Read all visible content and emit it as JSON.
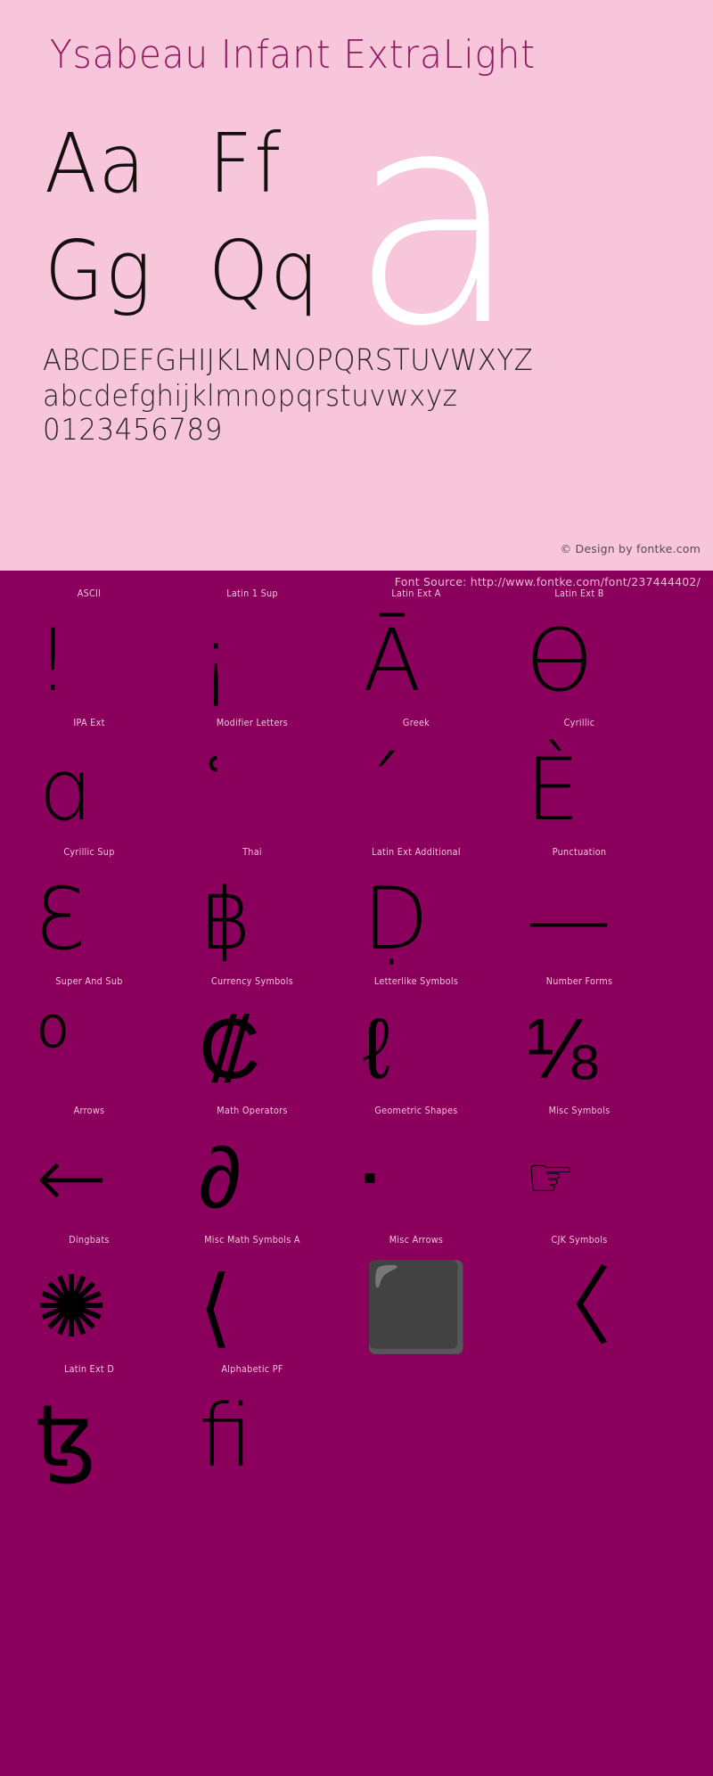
{
  "colors": {
    "background_pink": "#f7c6da",
    "background_magenta": "#8a005c",
    "title_magenta": "#8e1a63",
    "glyph_black": "#000000",
    "hero_white": "#ffffff",
    "label_pink": "#f2c4da"
  },
  "specimen": {
    "title": "Ysabeau Infant ExtraLight",
    "letter_pairs": [
      "Aa",
      "Ff",
      "Gg",
      "Qq"
    ],
    "hero_glyph": "a",
    "alphabet_upper": "ABCDEFGHIJKLMNOPQRSTUVWXYZ",
    "alphabet_lower": "abcdefghijklmnopqrstuvwxyz",
    "digits": "0123456789",
    "design_credit": "© Design by fontke.com"
  },
  "source": {
    "label": "Font Source: http://www.fontke.com/font/237444402/"
  },
  "grid": {
    "rows": [
      [
        {
          "label": "ASCII",
          "glyph": "!",
          "icon": "exclamation-glyph",
          "size": "tall",
          "align": "offset-left"
        },
        {
          "label": "Latin 1 Sup",
          "glyph": "¡",
          "icon": "inverted-exclamation-glyph",
          "size": "tall",
          "align": "offset-left"
        },
        {
          "label": "Latin Ext A",
          "glyph": "Ā",
          "icon": "a-macron-glyph",
          "size": "tall",
          "align": "offset-left"
        },
        {
          "label": "Latin Ext B",
          "glyph": "Ɵ",
          "icon": "barred-o-glyph",
          "size": "tall",
          "align": "offset-left"
        }
      ],
      [
        {
          "label": "IPA Ext",
          "glyph": "ɑ",
          "icon": "latin-alpha-glyph",
          "size": "tall",
          "align": "offset-left"
        },
        {
          "label": "Modifier Letters",
          "glyph": "ʿ",
          "icon": "modifier-half-ring-glyph",
          "size": "tall",
          "align": "offset-left"
        },
        {
          "label": "Greek",
          "glyph": "΄",
          "icon": "greek-tonos-glyph",
          "size": "tall",
          "align": "offset-left"
        },
        {
          "label": "Cyrillic",
          "glyph": "Ѐ",
          "icon": "cyrillic-ie-grave-glyph",
          "size": "tall",
          "align": "offset-left"
        }
      ],
      [
        {
          "label": "Cyrillic Sup",
          "glyph": "Ԑ",
          "icon": "cyrillic-reversed-ze-glyph",
          "size": "tall",
          "align": "offset-left"
        },
        {
          "label": "Thai",
          "glyph": "฿",
          "icon": "thai-baht-glyph",
          "size": "tall",
          "align": "offset-left"
        },
        {
          "label": "Latin Ext Additional",
          "glyph": "Ḍ",
          "icon": "d-dot-below-glyph",
          "size": "tall",
          "align": "offset-left"
        },
        {
          "label": "Punctuation",
          "glyph": "—",
          "icon": "em-dash-glyph",
          "size": "tall",
          "align": "offset-left"
        }
      ],
      [
        {
          "label": "Super And Sub",
          "glyph": "⁰",
          "icon": "superscript-zero-glyph",
          "size": "tall",
          "align": "offset-left"
        },
        {
          "label": "Currency Symbols",
          "glyph": "₡",
          "icon": "colon-currency-glyph",
          "size": "tall",
          "align": "offset-left"
        },
        {
          "label": "Letterlike Symbols",
          "glyph": "ℓ",
          "icon": "script-small-l-glyph",
          "size": "tall",
          "align": "offset-left"
        },
        {
          "label": "Number Forms",
          "glyph": "⅛",
          "icon": "one-eighth-fraction-glyph",
          "size": "tall",
          "align": "offset-left"
        }
      ],
      [
        {
          "label": "Arrows",
          "glyph": "←",
          "icon": "left-arrow-glyph",
          "size": "tall",
          "align": "offset-left"
        },
        {
          "label": "Math Operators",
          "glyph": "∂",
          "icon": "partial-differential-glyph",
          "size": "tall",
          "align": "offset-left"
        },
        {
          "label": "Geometric Shapes",
          "glyph": "▪",
          "icon": "small-black-square-glyph",
          "size": "mini",
          "align": "offset-left"
        },
        {
          "label": "Misc Symbols",
          "glyph": "☞",
          "icon": "pointing-hand-glyph",
          "size": "small",
          "align": "offset-left"
        }
      ],
      [
        {
          "label": "Dingbats",
          "glyph": "✺",
          "icon": "bird-dingbat-glyph",
          "size": "tall",
          "align": "offset-left"
        },
        {
          "label": "Misc Math Symbols A",
          "glyph": "⟨",
          "icon": "left-angle-bracket-glyph",
          "size": "tall",
          "align": "offset-left"
        },
        {
          "label": "Misc Arrows",
          "glyph": "⬛",
          "icon": "black-rectangle-glyph",
          "size": "tall",
          "align": "offset-left"
        },
        {
          "label": "CJK Symbols",
          "glyph": "〈",
          "icon": "cjk-angle-bracket-glyph",
          "size": "tall",
          "align": "offset-left"
        }
      ],
      [
        {
          "label": "Latin Ext D",
          "glyph": "ꜩ",
          "icon": "tz-ligature-glyph",
          "size": "tall",
          "align": "offset-left"
        },
        {
          "label": "Alphabetic PF",
          "glyph": "ﬁ",
          "icon": "fi-ligature-glyph",
          "size": "tall",
          "align": "offset-left"
        }
      ]
    ]
  }
}
